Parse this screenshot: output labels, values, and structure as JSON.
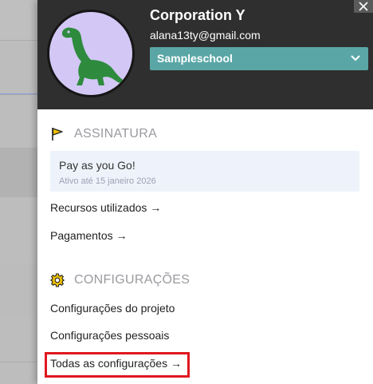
{
  "header": {
    "org_name": "Corporation Y",
    "email": "alana13ty@gmail.com",
    "school_select": {
      "value": "Sampleschool"
    }
  },
  "subscription": {
    "title": "ASSINATURA",
    "plan_name": "Pay as you Go!",
    "plan_status": "Ativo até 15 janeiro 2026",
    "links": [
      {
        "label": "Recursos utilizados →"
      },
      {
        "label": "Pagamentos →"
      }
    ]
  },
  "settings": {
    "title": "CONFIGURAÇÕES",
    "links": [
      {
        "label": "Configurações do projeto"
      },
      {
        "label": "Configurações pessoais"
      },
      {
        "label": "Todas as configurações →"
      }
    ]
  },
  "colors": {
    "header_bg": "#2f2f2f",
    "avatar_bg": "#d3c8f5",
    "dino": "#2e8b3e",
    "select_bg": "#5aa6a6",
    "highlight": "#e0171f",
    "flag_icon": "#d9a400",
    "gear_icon": "#e6b800"
  },
  "icons": {
    "avatar": "dinosaur-icon",
    "select_caret": "chevron-down-icon",
    "close": "close-icon",
    "subscription": "flag-icon",
    "settings": "gear-icon"
  }
}
